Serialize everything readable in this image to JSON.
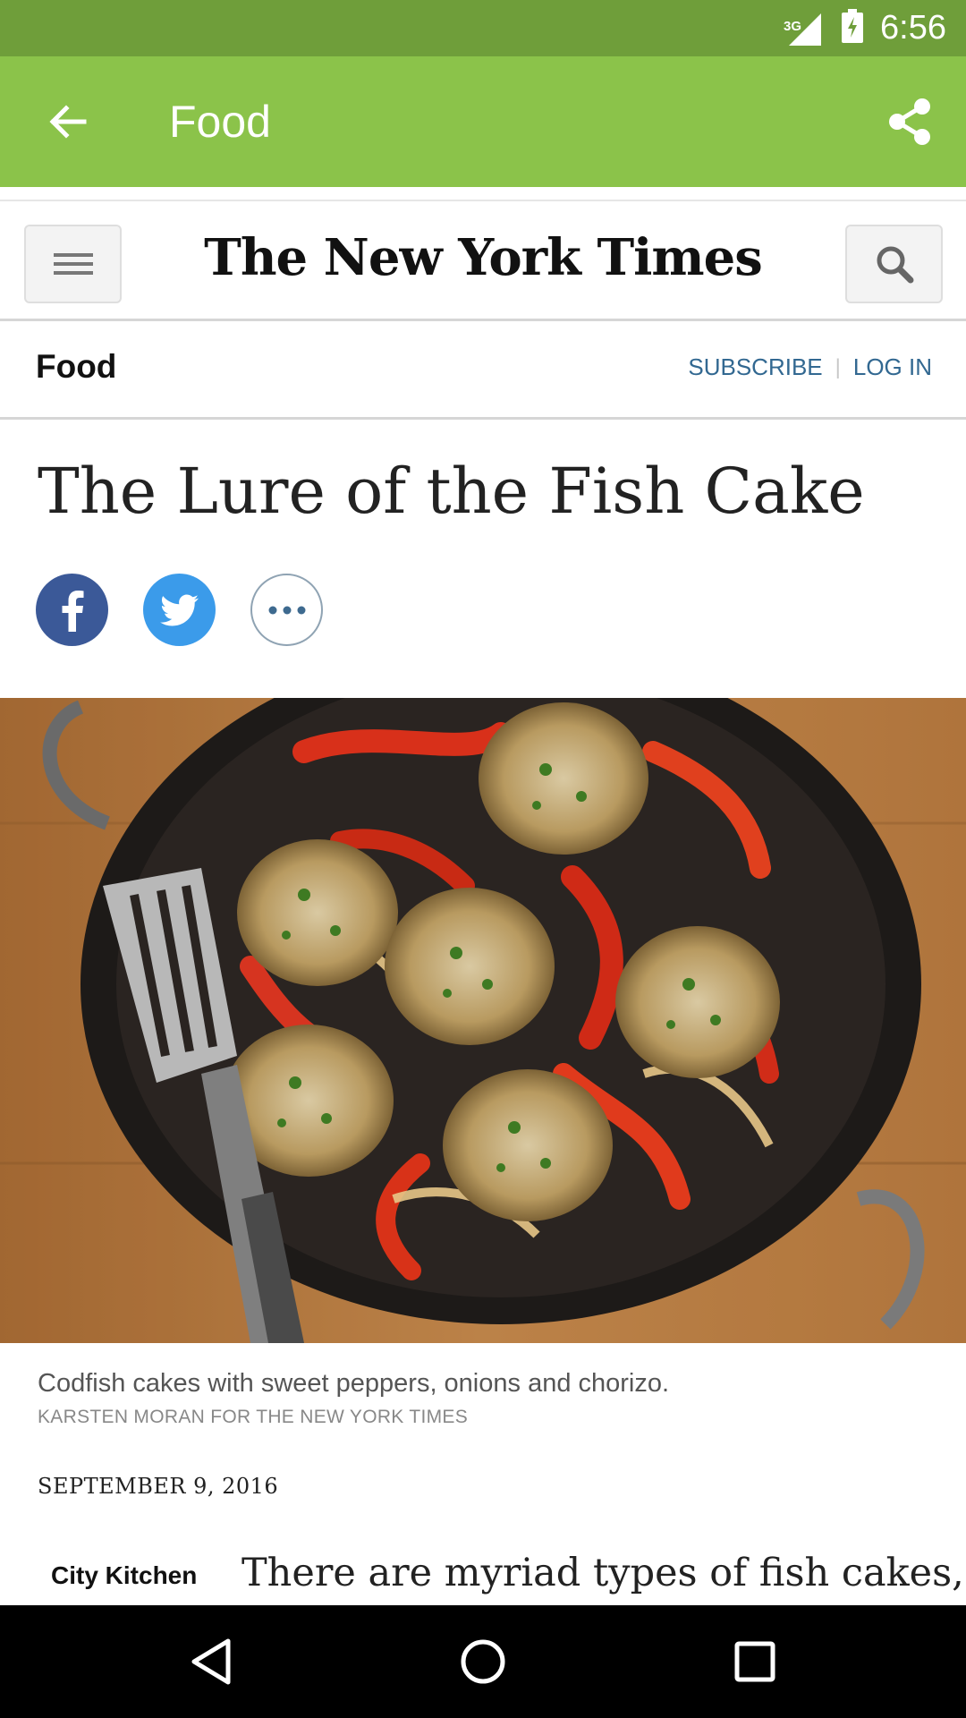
{
  "status_bar": {
    "network_type": "3G",
    "time": "6:56",
    "icons": [
      "signal-icon",
      "battery-icon"
    ]
  },
  "app_bar": {
    "title": "Food",
    "icons": [
      "back-arrow-icon",
      "share-icon"
    ]
  },
  "site_header": {
    "logo_text": "The New York Times",
    "icons": [
      "hamburger-menu-icon",
      "search-icon"
    ]
  },
  "section_bar": {
    "section": "Food",
    "subscribe_label": "SUBSCRIBE",
    "separator": "|",
    "login_label": "LOG IN"
  },
  "article": {
    "headline": "The Lure of the Fish Cake",
    "share_icons": [
      "facebook-icon",
      "twitter-icon",
      "more-icon"
    ],
    "image_alt_icon": "fish-cakes-in-pan-photo",
    "caption": "Codfish cakes with sweet peppers, onions and chorizo.",
    "credit": "KARSTEN MORAN FOR THE NEW YORK TIMES",
    "date": "SEPTEMBER 9, 2016",
    "kicker": "City Kitchen",
    "first_line": "There are myriad types of fish cakes,"
  },
  "nav_bar": {
    "icons": [
      "nav-back-icon",
      "nav-home-icon",
      "nav-recents-icon"
    ]
  },
  "colors": {
    "status_bar": "#6f9e3a",
    "app_bar": "#8bc34a",
    "link": "#326891",
    "facebook": "#3b5998",
    "twitter": "#3b9bea"
  }
}
